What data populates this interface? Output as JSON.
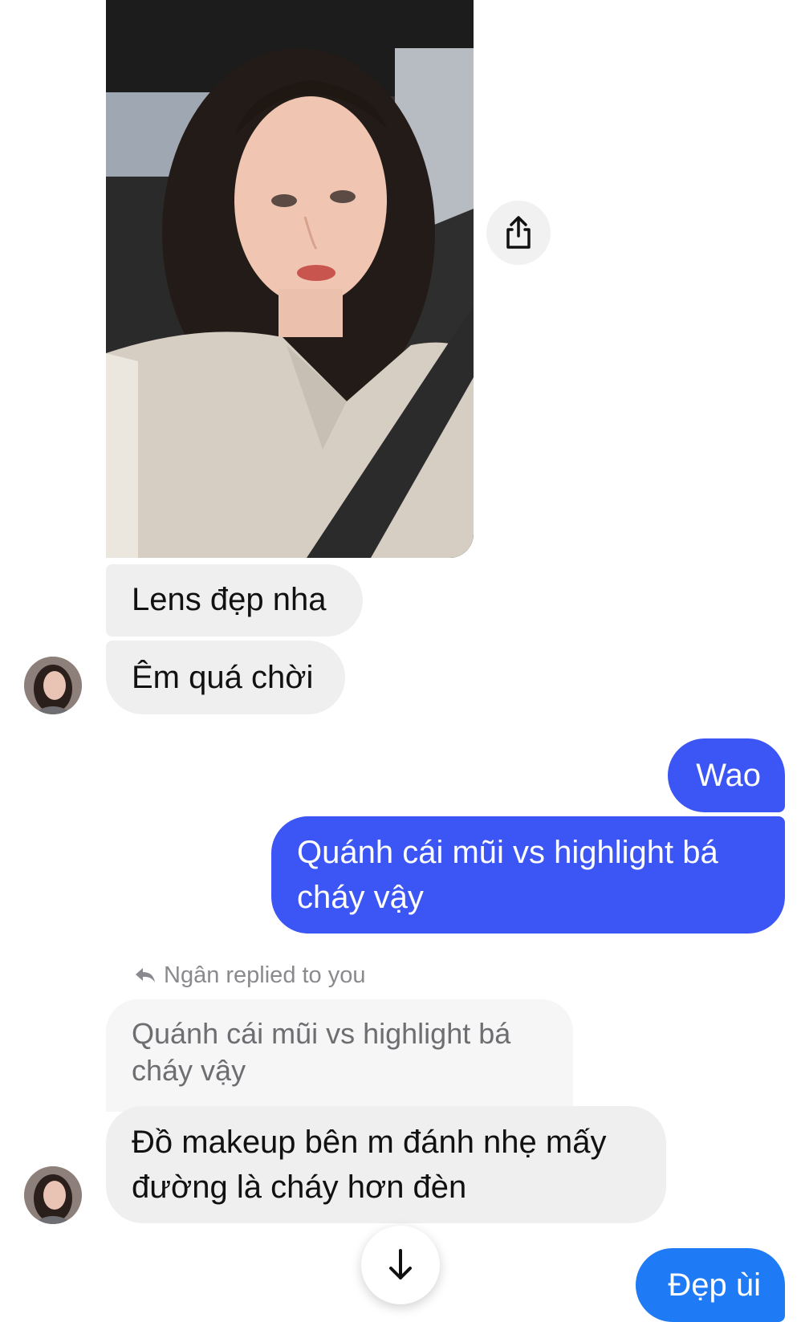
{
  "colors": {
    "incoming_bubble": "#efefef",
    "outgoing_bubble": "#3c55f5",
    "outgoing_bubble_latest": "#1e7af5",
    "reply_label": "#8a8a8e"
  },
  "attachment": {
    "share_icon": "share-icon"
  },
  "messages": {
    "incoming_1": "Lens đẹp nha",
    "incoming_2": "Êm quá chời",
    "outgoing_1": "Wao",
    "outgoing_2": "Quánh cái mũi vs highlight bá cháy vậy",
    "reply_label": "Ngân replied to you",
    "quoted": "Quánh cái mũi vs highlight bá cháy vậy",
    "incoming_3": "Đồ makeup bên m đánh nhẹ mấy đường là cháy hơn đèn",
    "outgoing_3": "Đẹp ùi"
  },
  "controls": {
    "scroll_icon": "arrow-down-icon"
  }
}
